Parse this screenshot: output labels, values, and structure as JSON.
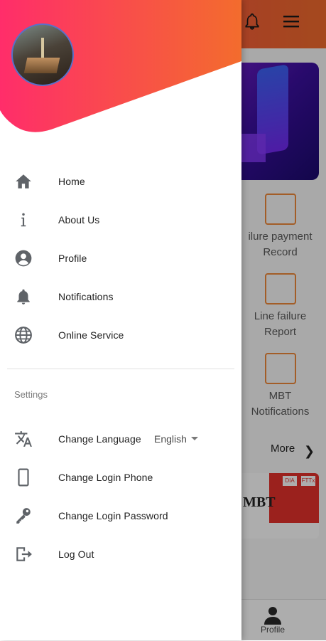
{
  "drawer": {
    "menu_items": [
      {
        "label": "Home",
        "icon": "home-icon"
      },
      {
        "label": "About Us",
        "icon": "info-icon"
      },
      {
        "label": "Profile",
        "icon": "account-circle-icon"
      },
      {
        "label": "Notifications",
        "icon": "bell-icon"
      },
      {
        "label": "Online Service",
        "icon": "globe-icon"
      }
    ],
    "settings_title": "Settings",
    "settings_items": [
      {
        "label": "Change Language",
        "icon": "translate-icon",
        "value": "English"
      },
      {
        "label": "Change Login Phone",
        "icon": "phone-icon"
      },
      {
        "label": "Change Login Password",
        "icon": "key-icon"
      },
      {
        "label": "Log Out",
        "icon": "logout-icon"
      }
    ]
  },
  "background": {
    "services": [
      {
        "line1": "ilure payment",
        "line2": "Record"
      },
      {
        "line1": "Line failure",
        "line2": "Report"
      },
      {
        "line1": "MBT",
        "line2": "Notifications"
      }
    ],
    "more_label": "More",
    "card_title": "MBT",
    "card_tags": [
      "DIA",
      "FTTx"
    ],
    "bottom_nav_label": "Profile"
  },
  "colors": {
    "header_gradient_start": "#ff2d6a",
    "header_gradient_end": "#f36c2d",
    "icon_gray": "#5f6368",
    "avatar_border": "#5870c9"
  }
}
